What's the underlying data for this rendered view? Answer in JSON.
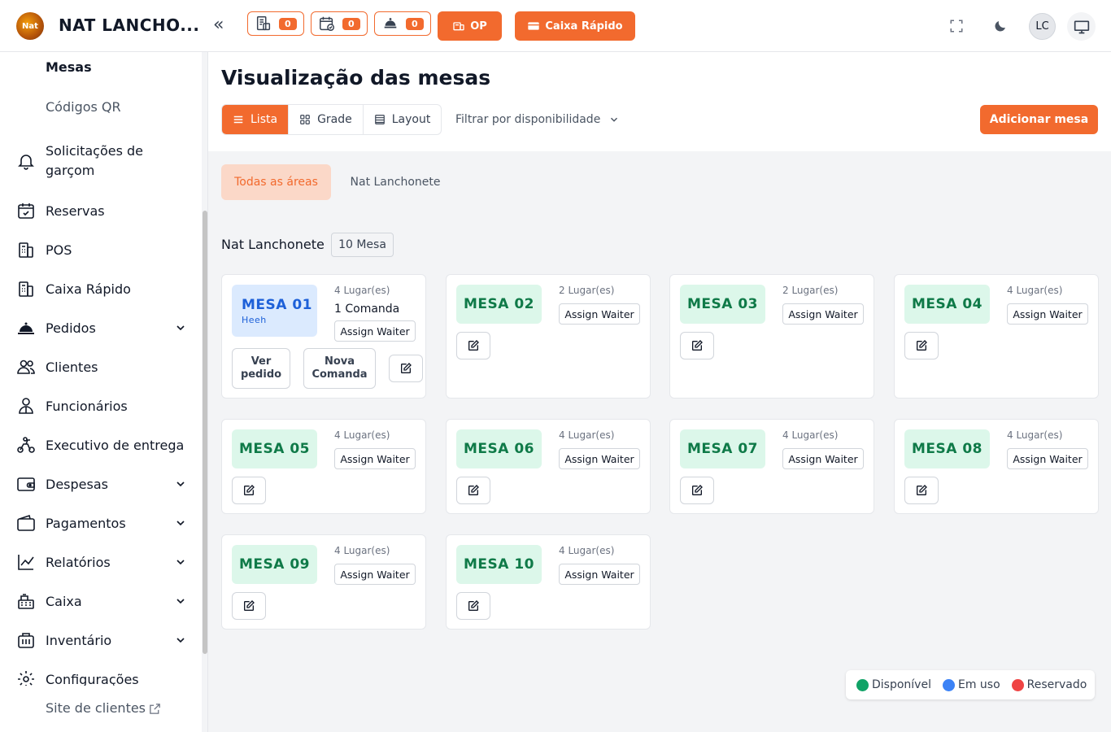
{
  "header": {
    "app_title": "NAT LANCHO...",
    "logo_text": "Nat",
    "counters": [
      {
        "icon": "receipt-icon",
        "count": "0"
      },
      {
        "icon": "calendar-check-icon",
        "count": "0"
      },
      {
        "icon": "waiter-icon",
        "count": "0"
      }
    ],
    "op_label": "OP",
    "quick_cash_label": "Caixa Rápido",
    "avatar_initials": "LC"
  },
  "sidebar": {
    "sub_items": [
      "Mesas",
      "Códigos QR"
    ],
    "items": [
      {
        "label": "Solicitações de garçom",
        "icon": "bell-icon",
        "expandable": false
      },
      {
        "label": "Reservas",
        "icon": "calendar-icon",
        "expandable": false
      },
      {
        "label": "POS",
        "icon": "pos-icon",
        "expandable": false
      },
      {
        "label": "Caixa Rápido",
        "icon": "pos-icon",
        "expandable": false
      },
      {
        "label": "Pedidos",
        "icon": "cloche-icon",
        "expandable": true
      },
      {
        "label": "Clientes",
        "icon": "users-icon",
        "expandable": false
      },
      {
        "label": "Funcionários",
        "icon": "staff-icon",
        "expandable": false
      },
      {
        "label": "Executivo de entrega",
        "icon": "delivery-icon",
        "expandable": false
      },
      {
        "label": "Despesas",
        "icon": "wallet-icon",
        "expandable": true
      },
      {
        "label": "Pagamentos",
        "icon": "wallet-open-icon",
        "expandable": true
      },
      {
        "label": "Relatórios",
        "icon": "chart-icon",
        "expandable": true
      },
      {
        "label": "Caixa",
        "icon": "register-icon",
        "expandable": true
      },
      {
        "label": "Inventário",
        "icon": "inventory-icon",
        "expandable": true
      },
      {
        "label": "Configurações",
        "icon": "gear-icon",
        "expandable": false
      }
    ],
    "site_link": "Site de clientes"
  },
  "main": {
    "title": "Visualização das mesas",
    "views": [
      {
        "label": "Lista",
        "active": true
      },
      {
        "label": "Grade",
        "active": false
      },
      {
        "label": "Layout",
        "active": false
      }
    ],
    "filter_label": "Filtrar por disponibilidade",
    "add_label": "Adicionar mesa",
    "area_tabs": [
      "Todas as áreas",
      "Nat Lanchonete"
    ],
    "group": {
      "title": "Nat Lanchonete",
      "count": "10 Mesa"
    },
    "assign_label": "Assign Waiter",
    "view_order_label": "Ver pedido",
    "new_comanda_label": "Nova Comanda",
    "tables": [
      {
        "name": "MESA 01",
        "seats": "4 Lugar(es)",
        "status": "in-use",
        "guest": "Heeh",
        "comandas": "1 Comanda"
      },
      {
        "name": "MESA 02",
        "seats": "2 Lugar(es)",
        "status": "available"
      },
      {
        "name": "MESA 03",
        "seats": "2 Lugar(es)",
        "status": "available"
      },
      {
        "name": "MESA 04",
        "seats": "4 Lugar(es)",
        "status": "available"
      },
      {
        "name": "MESA 05",
        "seats": "4 Lugar(es)",
        "status": "available"
      },
      {
        "name": "MESA 06",
        "seats": "4 Lugar(es)",
        "status": "available"
      },
      {
        "name": "MESA 07",
        "seats": "4 Lugar(es)",
        "status": "available"
      },
      {
        "name": "MESA 08",
        "seats": "4 Lugar(es)",
        "status": "available"
      },
      {
        "name": "MESA 09",
        "seats": "4 Lugar(es)",
        "status": "available"
      },
      {
        "name": "MESA 10",
        "seats": "4 Lugar(es)",
        "status": "available"
      }
    ]
  },
  "legend": [
    {
      "label": "Disponível",
      "color": "#10a266"
    },
    {
      "label": "Em uso",
      "color": "#3b82f6"
    },
    {
      "label": "Reservado",
      "color": "#ef4444"
    }
  ],
  "colors": {
    "accent": "#f26a2e",
    "available_bg": "#dcf7ea",
    "available_text": "#0f7a48",
    "inuse_bg": "#dbeafe",
    "inuse_text": "#1d60d8"
  }
}
